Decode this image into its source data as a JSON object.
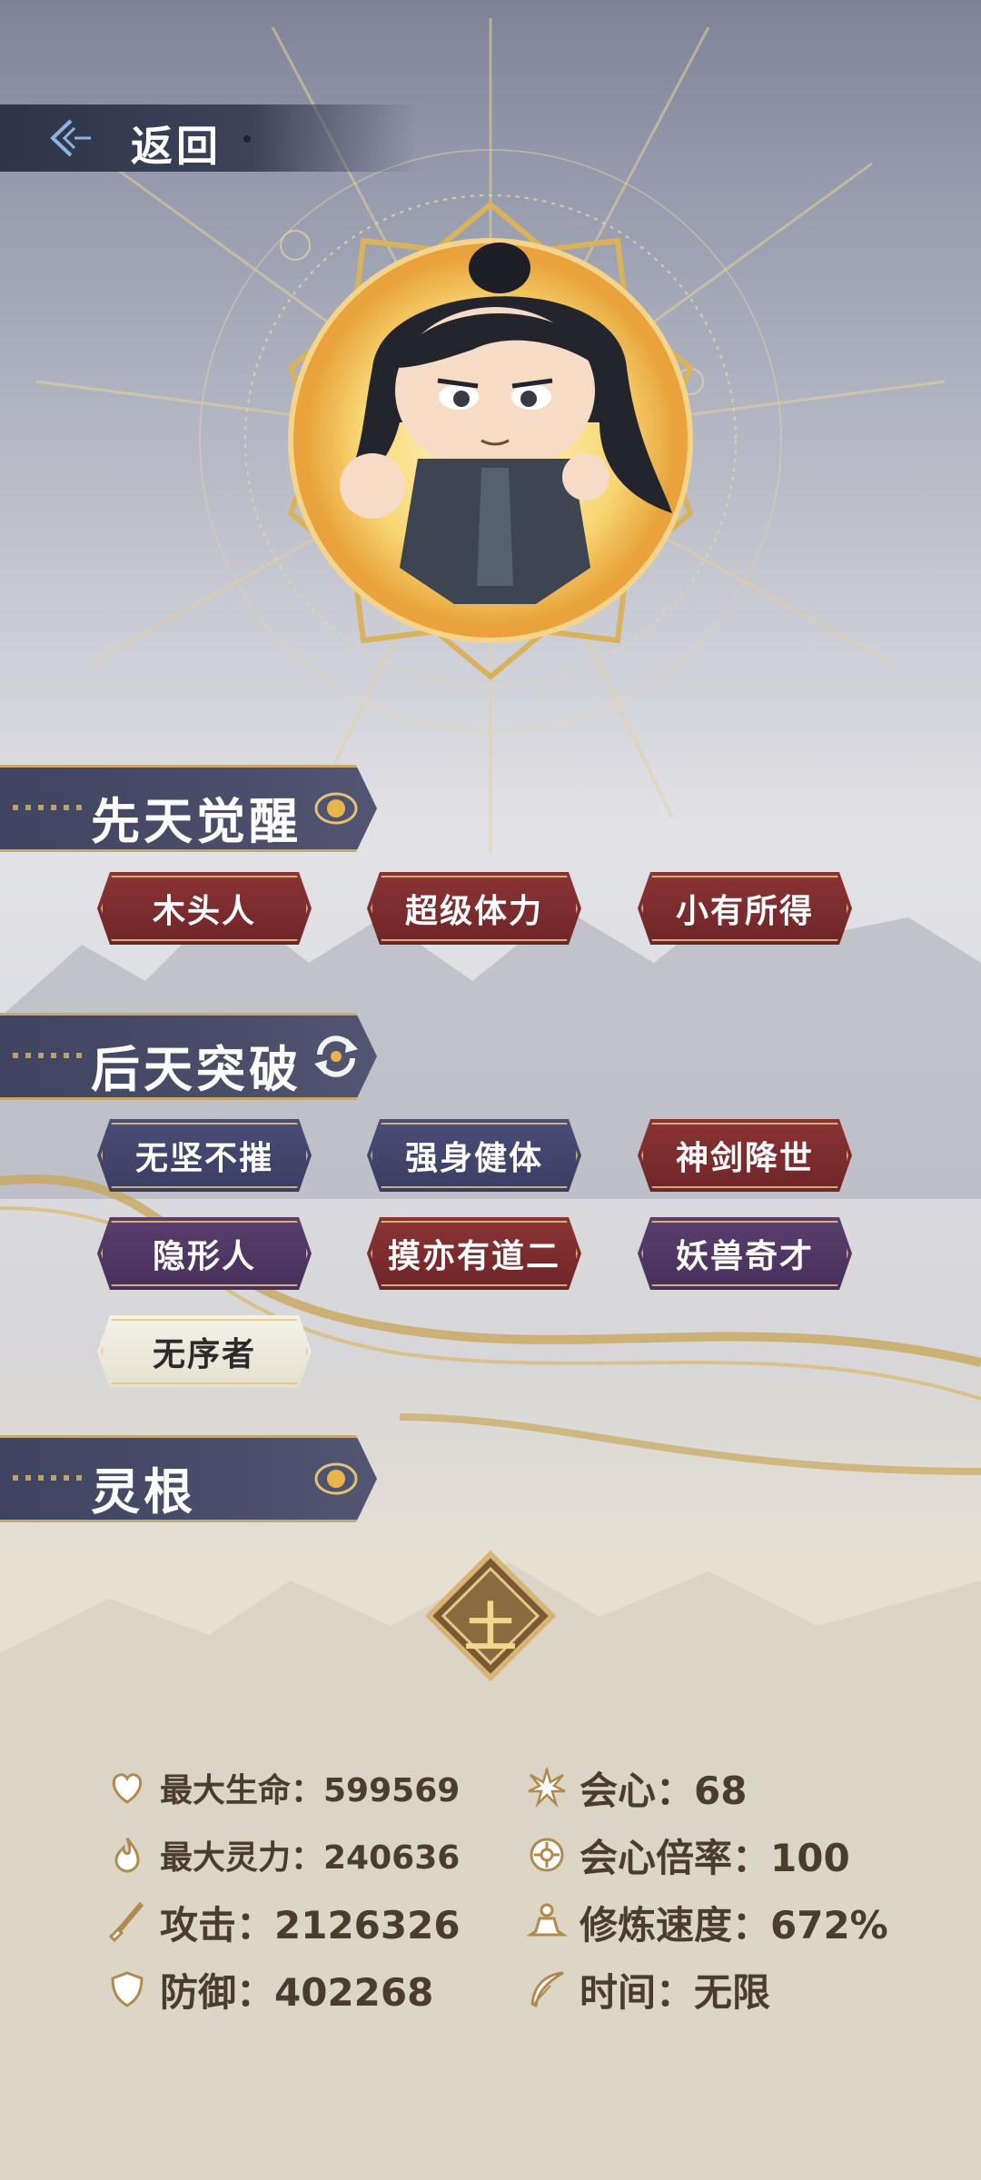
{
  "header": {
    "back_label": "返回"
  },
  "sections": {
    "innate": {
      "title": "先天觉醒",
      "tags": [
        {
          "label": "木头人",
          "style": "red"
        },
        {
          "label": "超级体力",
          "style": "red"
        },
        {
          "label": "小有所得",
          "style": "red"
        }
      ]
    },
    "acquired": {
      "title": "后天突破",
      "tags": [
        {
          "label": "无坚不摧",
          "style": "blue"
        },
        {
          "label": "强身健体",
          "style": "blue"
        },
        {
          "label": "神剑降世",
          "style": "red"
        },
        {
          "label": "隐形人",
          "style": "purple"
        },
        {
          "label": "摸亦有道二",
          "style": "red"
        },
        {
          "label": "妖兽奇才",
          "style": "purple"
        },
        {
          "label": "无序者",
          "style": "light"
        }
      ]
    },
    "spirit_root": {
      "title": "灵根",
      "element": "土"
    }
  },
  "stats": {
    "max_hp": "最大生命：599569",
    "max_mana": "最大灵力：240636",
    "attack": "攻击：2126326",
    "defense": "防御：402268",
    "crit": "会心：68",
    "crit_rate": "会心倍率：100",
    "cultivation_speed": "修炼速度：672%",
    "time": "时间：无限"
  },
  "colors": {
    "gold": "#c8a76a",
    "text_brown": "#4b3d2c",
    "header_bg": "#3f4461"
  }
}
